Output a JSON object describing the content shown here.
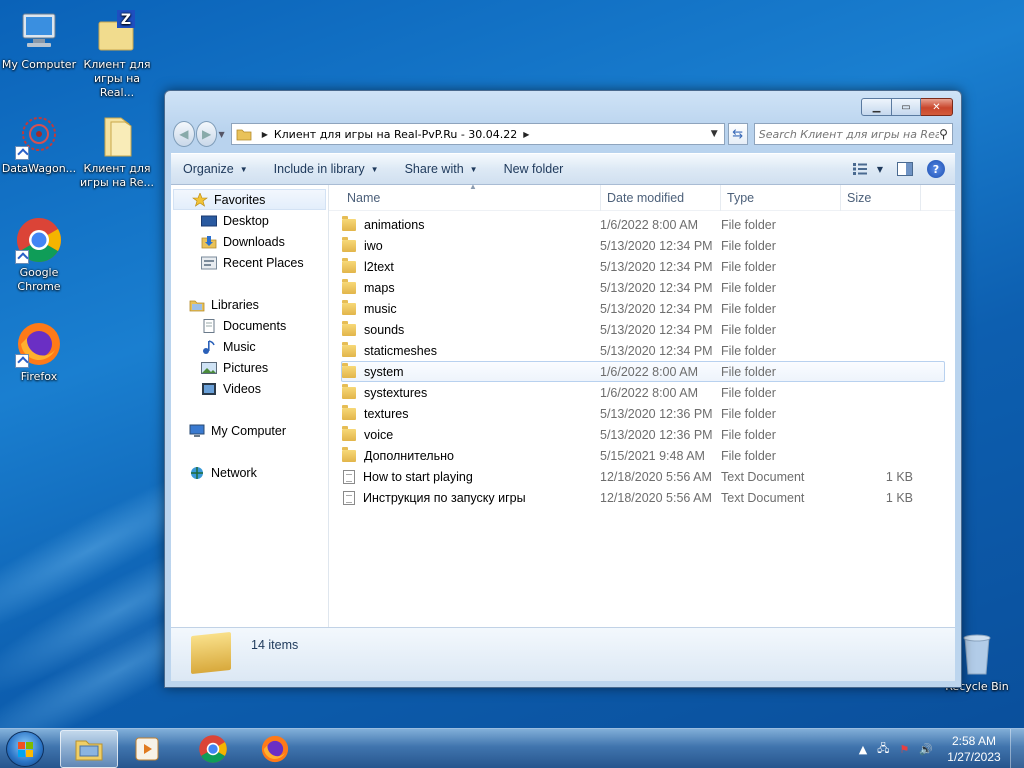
{
  "desktop": {
    "icons": [
      {
        "label": "My Computer",
        "icon": "computer-icon"
      },
      {
        "label": "Клиент для игры на Real...",
        "icon": "archive-icon"
      },
      {
        "label": "DataWagon...",
        "icon": "datawagon-icon"
      },
      {
        "label": "Клиент для игры на Re...",
        "icon": "folder-icon"
      },
      {
        "label": "Google Chrome",
        "icon": "chrome-icon"
      },
      {
        "label": "Firefox",
        "icon": "firefox-icon"
      },
      {
        "label": "Recycle Bin",
        "icon": "recycle-bin-icon"
      }
    ]
  },
  "window": {
    "address": {
      "crumb": "Клиент для игры на Real-PvP.Ru - 30.04.22"
    },
    "search": {
      "placeholder": "Search Клиент для игры на Real-Pv..."
    },
    "toolbar": {
      "organize": "Organize",
      "include": "Include in library",
      "share": "Share with",
      "new_folder": "New folder"
    },
    "nav": {
      "favorites": "Favorites",
      "desktop": "Desktop",
      "downloads": "Downloads",
      "recent": "Recent Places",
      "libraries": "Libraries",
      "documents": "Documents",
      "music": "Music",
      "pictures": "Pictures",
      "videos": "Videos",
      "computer": "My Computer",
      "network": "Network"
    },
    "columns": {
      "name": "Name",
      "date": "Date modified",
      "type": "Type",
      "size": "Size"
    },
    "files": [
      {
        "name": "animations",
        "date": "1/6/2022 8:00 AM",
        "type": "File folder",
        "size": "",
        "kind": "folder"
      },
      {
        "name": "iwo",
        "date": "5/13/2020 12:34 PM",
        "type": "File folder",
        "size": "",
        "kind": "folder"
      },
      {
        "name": "l2text",
        "date": "5/13/2020 12:34 PM",
        "type": "File folder",
        "size": "",
        "kind": "folder"
      },
      {
        "name": "maps",
        "date": "5/13/2020 12:34 PM",
        "type": "File folder",
        "size": "",
        "kind": "folder"
      },
      {
        "name": "music",
        "date": "5/13/2020 12:34 PM",
        "type": "File folder",
        "size": "",
        "kind": "folder"
      },
      {
        "name": "sounds",
        "date": "5/13/2020 12:34 PM",
        "type": "File folder",
        "size": "",
        "kind": "folder"
      },
      {
        "name": "staticmeshes",
        "date": "5/13/2020 12:34 PM",
        "type": "File folder",
        "size": "",
        "kind": "folder"
      },
      {
        "name": "system",
        "date": "1/6/2022 8:00 AM",
        "type": "File folder",
        "size": "",
        "kind": "folder",
        "hover": true
      },
      {
        "name": "systextures",
        "date": "1/6/2022 8:00 AM",
        "type": "File folder",
        "size": "",
        "kind": "folder"
      },
      {
        "name": "textures",
        "date": "5/13/2020 12:36 PM",
        "type": "File folder",
        "size": "",
        "kind": "folder"
      },
      {
        "name": "voice",
        "date": "5/13/2020 12:36 PM",
        "type": "File folder",
        "size": "",
        "kind": "folder"
      },
      {
        "name": "Дополнительно",
        "date": "5/15/2021 9:48 AM",
        "type": "File folder",
        "size": "",
        "kind": "folder"
      },
      {
        "name": "How to start playing",
        "date": "12/18/2020 5:56 AM",
        "type": "Text Document",
        "size": "1 KB",
        "kind": "doc"
      },
      {
        "name": "Инструкция по запуску игры",
        "date": "12/18/2020 5:56 AM",
        "type": "Text Document",
        "size": "1 KB",
        "kind": "doc"
      }
    ],
    "status": {
      "count": "14 items"
    }
  },
  "taskbar": {
    "clock_time": "2:58 AM",
    "clock_date": "1/27/2023"
  }
}
